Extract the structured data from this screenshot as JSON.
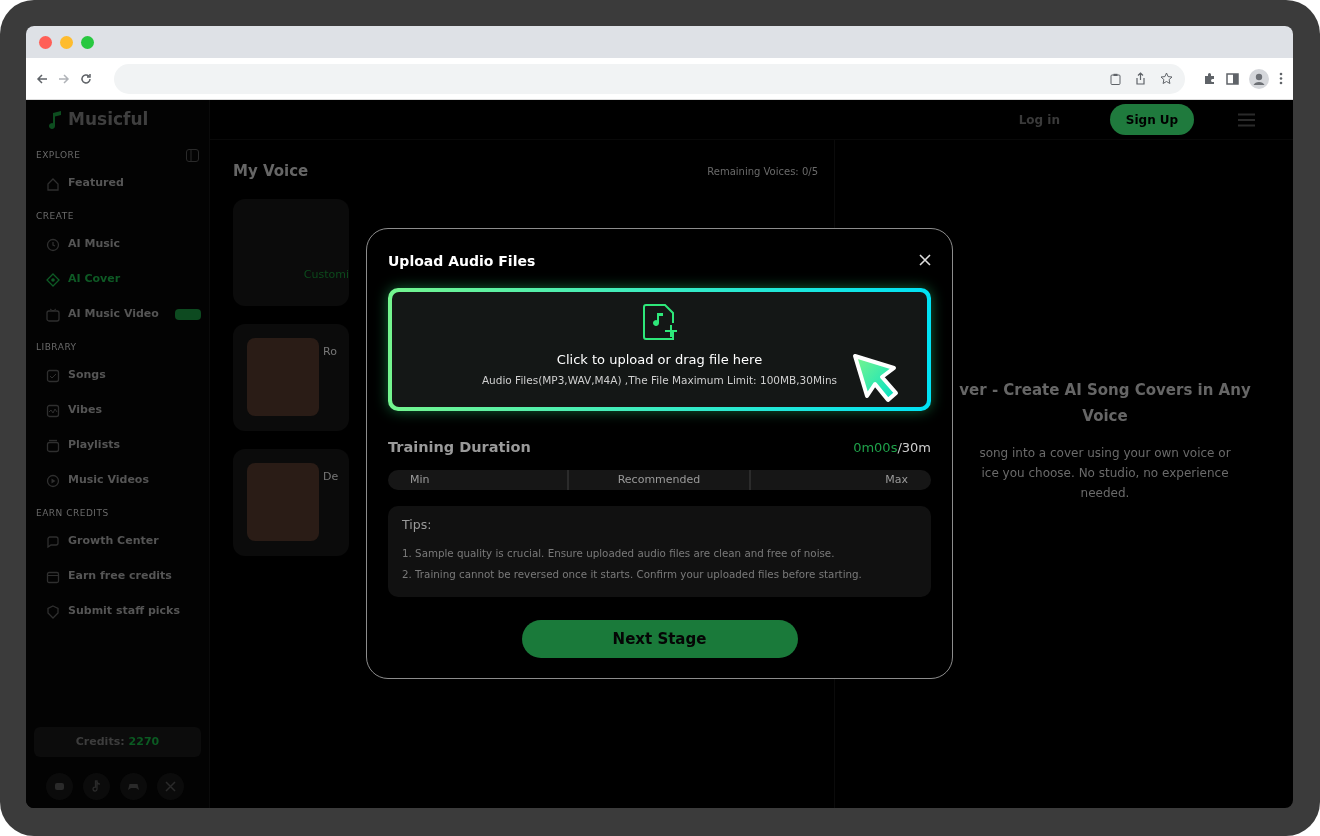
{
  "header": {
    "logo": "Musicful",
    "login": "Log in",
    "signup": "Sign Up"
  },
  "sidebar": {
    "sections": [
      {
        "title": "EXPLORE",
        "items": [
          {
            "label": "Featured",
            "selected": false
          }
        ]
      },
      {
        "title": "CREATE",
        "items": [
          {
            "label": "AI Music",
            "selected": false
          },
          {
            "label": "AI Cover",
            "selected": true
          },
          {
            "label": "AI Music Video",
            "selected": false,
            "new_badge": true
          }
        ]
      },
      {
        "title": "LIBRARY",
        "items": [
          {
            "label": "Songs",
            "selected": false
          },
          {
            "label": "Vibes",
            "selected": false
          },
          {
            "label": "Playlists",
            "selected": false
          },
          {
            "label": "Music Videos",
            "selected": false
          }
        ]
      },
      {
        "title": "EARN CREDITS",
        "items": [
          {
            "label": "Growth Center",
            "selected": false
          },
          {
            "label": "Earn free credits",
            "selected": false
          },
          {
            "label": "Submit staff picks",
            "selected": false
          }
        ]
      }
    ],
    "credits_label": "Credits:",
    "credits_value": "2270"
  },
  "main": {
    "title": "My Voice",
    "remaining": "Remaining Voices: 0/5",
    "custom_card": {
      "label": "Customi"
    },
    "voices": [
      {
        "name": "Ro"
      },
      {
        "name": "De"
      }
    ]
  },
  "right_panel": {
    "heading_lines": [
      "ver - Create AI Song Covers in Any",
      "Voice"
    ],
    "description_lines": [
      "song into a cover using your own voice or",
      "ice you choose. No studio, no experience",
      "needed."
    ]
  },
  "modal": {
    "title": "Upload Audio Files",
    "upload_title": "Click to upload or drag file here",
    "upload_hint": "Audio Files(MP3,WAV,M4A) ,The File Maximum Limit: 100MB,30Mins",
    "duration_label": "Training Duration",
    "duration_value": "0m00s",
    "duration_total": "/30m",
    "scale": [
      "Min",
      "Recommended",
      "Max"
    ],
    "tips_title": "Tips:",
    "tips": [
      "1. Sample quality is crucial. Ensure uploaded audio files are clean and free of noise.",
      "2. Training cannot be reversed once it starts. Confirm your uploaded files before starting."
    ],
    "button": "Next Stage"
  }
}
